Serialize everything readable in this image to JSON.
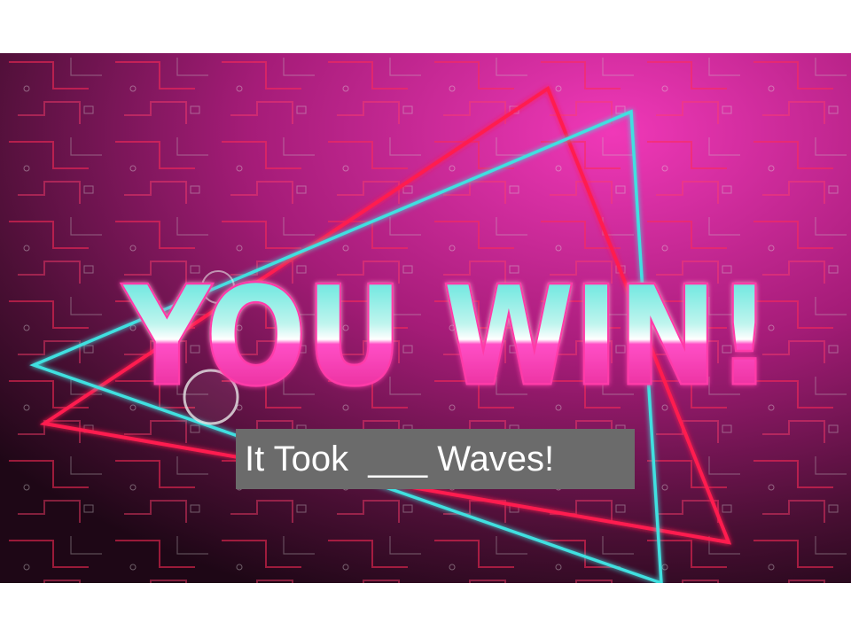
{
  "banner": {
    "headline": "YOU WIN!",
    "caption": "It Took  ___ Waves!"
  },
  "colors": {
    "background_light": "#e0218a",
    "background_dark": "#2a0a1e",
    "neon_cyan": "#3fe0e0",
    "neon_red": "#ff1f4f",
    "text_pink": "#ff4fc6",
    "caption_box": "#6b6b6b"
  }
}
